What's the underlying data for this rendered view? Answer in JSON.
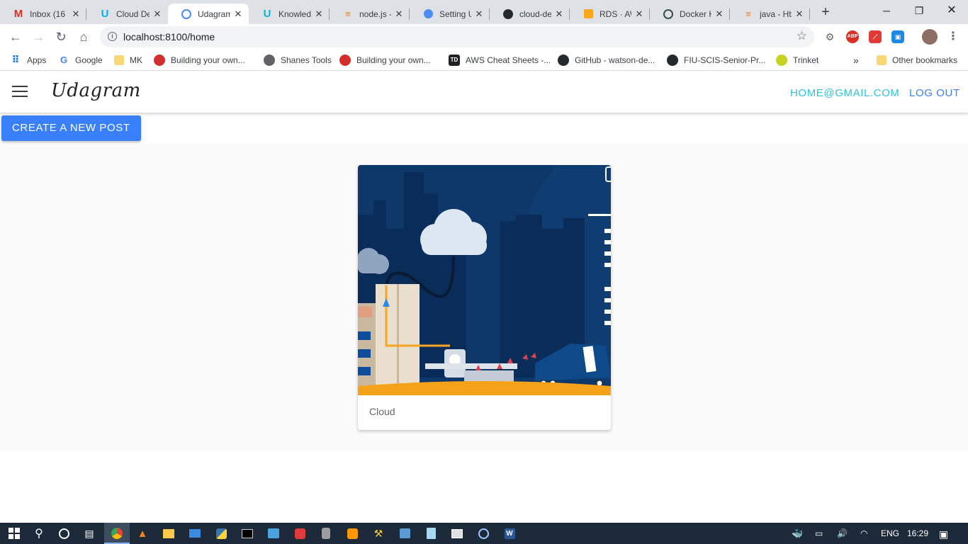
{
  "browser": {
    "tabs": [
      {
        "label": "Inbox (16",
        "icon": "gmail-icon"
      },
      {
        "label": "Cloud De",
        "icon": "udacity-icon"
      },
      {
        "label": "Udagram",
        "icon": "globe-icon",
        "active": true
      },
      {
        "label": "Knowled",
        "icon": "udacity-icon"
      },
      {
        "label": "node.js -",
        "icon": "stackoverflow-icon"
      },
      {
        "label": "Setting U",
        "icon": "globe-icon"
      },
      {
        "label": "cloud-de",
        "icon": "github-icon"
      },
      {
        "label": "RDS · AW",
        "icon": "aws-icon"
      },
      {
        "label": "Docker H",
        "icon": "docker-icon"
      },
      {
        "label": "java - Htt",
        "icon": "stackoverflow-icon"
      }
    ],
    "address_url": "localhost:8100/home",
    "bookmarks": [
      {
        "label": "Apps"
      },
      {
        "label": "Google"
      },
      {
        "label": "MK"
      },
      {
        "label": "Building your own..."
      },
      {
        "label": "Shanes Tools"
      },
      {
        "label": "Building your own..."
      },
      {
        "label": "AWS Cheat Sheets -..."
      },
      {
        "label": "GitHub - watson-de..."
      },
      {
        "label": "FIU-SCIS-Senior-Pr..."
      },
      {
        "label": "Trinket"
      }
    ],
    "bookmarks_overflow": "»",
    "other_bookmarks": "Other bookmarks"
  },
  "app": {
    "brand": "Udagram",
    "user_email": "HOME@GMAIL.COM",
    "logout_label": "LOG OUT",
    "create_post_label": "CREATE A NEW POST",
    "posts": [
      {
        "caption": "Cloud"
      }
    ],
    "colors": {
      "primary": "#3880ff",
      "email_link": "#2fc3dd",
      "logout_link": "#3880ff"
    }
  },
  "taskbar": {
    "language": "ENG",
    "time": "16:29"
  }
}
